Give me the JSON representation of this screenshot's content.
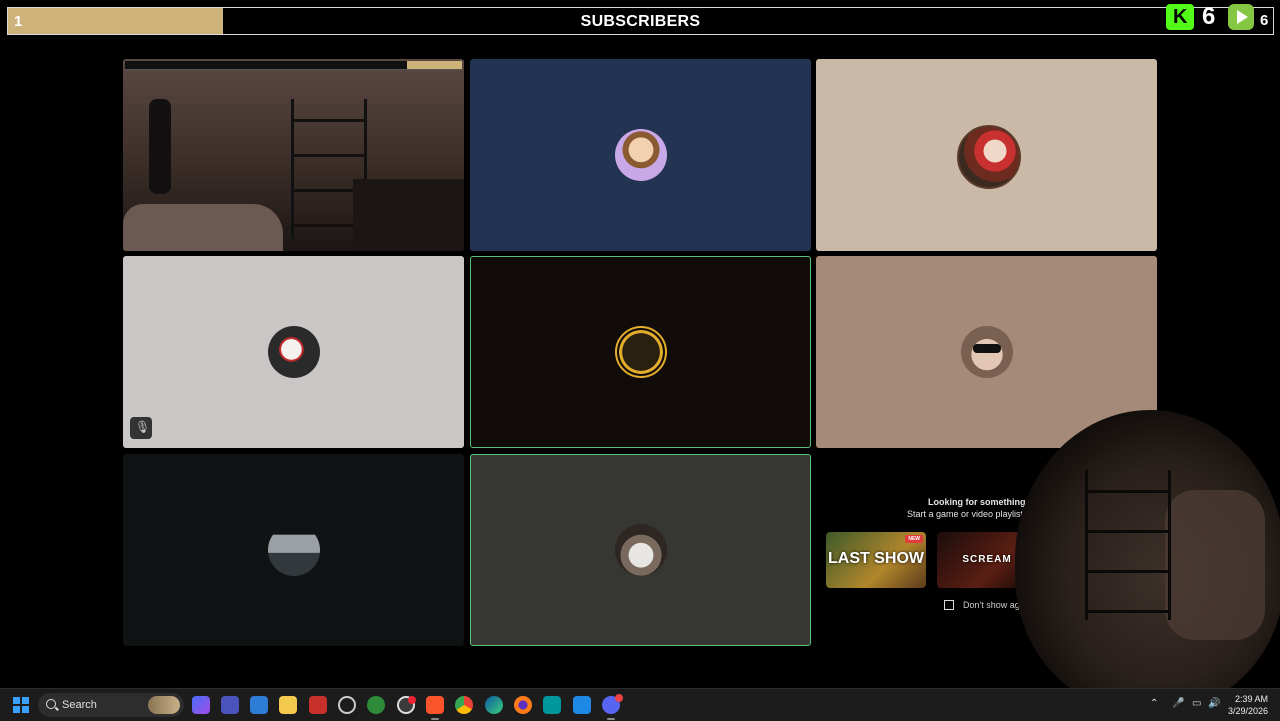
{
  "subscriber_bar": {
    "count": "1",
    "title": "SUBSCRIBERS",
    "progress_fraction": 0.17,
    "kick_count": "6",
    "rumble_count": "6"
  },
  "colors": {
    "subscriber_fill": "#cdb27a",
    "kick_green": "#53fc18",
    "rumble_green": "#85c742",
    "active_border": "#57c47a",
    "taskbar_bg": "#1c1c1c"
  },
  "tiles": [
    {
      "name": "webcam-tile",
      "kind": "camera",
      "bg": "#2a2220",
      "active": false
    },
    {
      "name": "participant-tile-2",
      "kind": "avatar",
      "bg": "#233452",
      "active": false,
      "avatar": "glasses-man-avatar"
    },
    {
      "name": "participant-tile-3",
      "kind": "avatar",
      "bg": "#cbb9a8",
      "active": false,
      "avatar": "mario-figure-avatar"
    },
    {
      "name": "participant-tile-4",
      "kind": "avatar",
      "bg": "#cac6c5",
      "active": false,
      "avatar": "joker-avatar",
      "muted": true
    },
    {
      "name": "participant-tile-5",
      "kind": "avatar",
      "bg": "#110c09",
      "active": true,
      "avatar": "gold-logo-avatar"
    },
    {
      "name": "participant-tile-6",
      "kind": "avatar",
      "bg": "#a58a7a",
      "active": false,
      "avatar": "sunglasses-man-avatar"
    },
    {
      "name": "participant-tile-7",
      "kind": "avatar",
      "bg": "#101313",
      "active": false,
      "avatar": "house-photo-avatar"
    },
    {
      "name": "participant-tile-8",
      "kind": "avatar",
      "bg": "#363632",
      "active": true,
      "avatar": "bearded-man-avatar"
    }
  ],
  "activity_prompt": {
    "heading": "Looking for something to do",
    "subheading": "Start a game or video playlist in",
    "cards": [
      {
        "label": "LAST SHOW",
        "badge": "NEW"
      },
      {
        "label": "SCREAM",
        "badge": ""
      }
    ],
    "checkbox_label": "Don't show again",
    "checkbox_checked": false
  },
  "taskbar": {
    "search_placeholder": "Search",
    "apps": [
      "copilot-icon",
      "teams-icon",
      "remote-icon",
      "file-explorer-icon",
      "news-icon",
      "clock-app-icon",
      "vpn-icon",
      "obs-icon",
      "brave-icon",
      "chrome-icon",
      "edge-icon",
      "firefox-icon",
      "arduino-icon",
      "vscode-icon",
      "discord-icon"
    ],
    "time": "2:39 AM",
    "date": "3/29/2026"
  }
}
